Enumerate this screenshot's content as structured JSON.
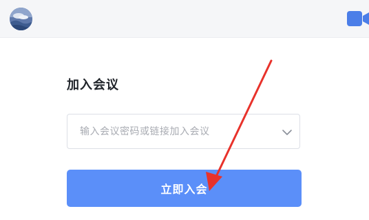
{
  "header": {
    "avatar_icon": "user-avatar-landscape",
    "video_icon": "video-camera-icon",
    "accent_color": "#4b7ee8"
  },
  "join_meeting": {
    "title": "加入会议",
    "input": {
      "placeholder": "输入会议密码或链接加入会议",
      "value": "",
      "dropdown_icon": "chevron-down-icon"
    },
    "join_button_label": "立即入会",
    "button_color": "#5b8ff9"
  },
  "annotation": {
    "type": "arrow",
    "color": "#e8322b",
    "points_to": "join-button"
  }
}
